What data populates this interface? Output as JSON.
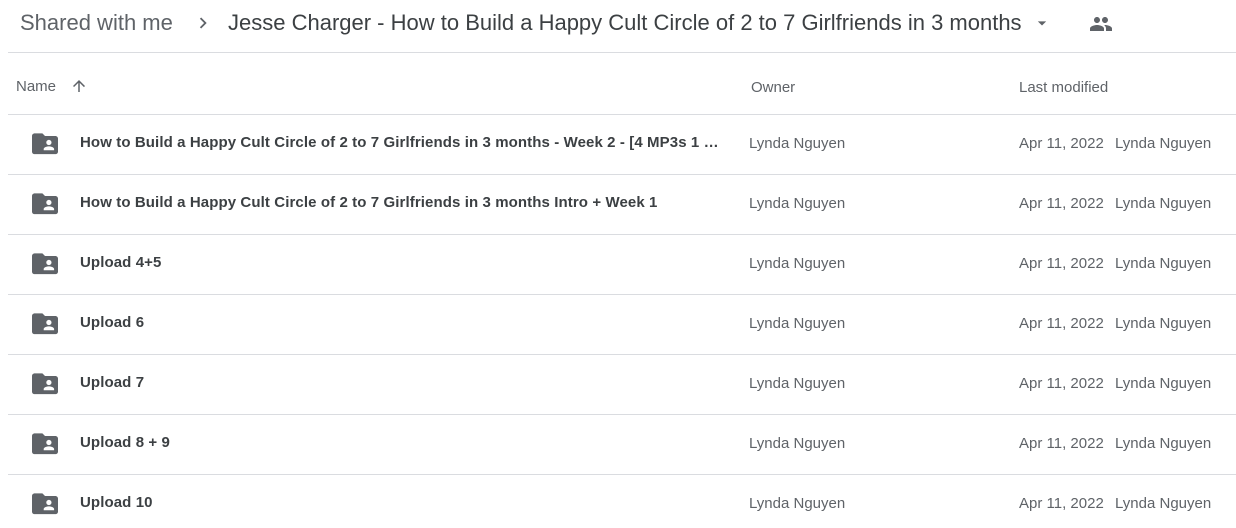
{
  "breadcrumb": {
    "root": "Shared with me",
    "current": "Jesse Charger - How to Build a Happy Cult Circle of 2 to 7 Girlfriends in 3 months"
  },
  "columns": {
    "name": "Name",
    "owner": "Owner",
    "last_modified": "Last modified",
    "sort_direction": "ascending"
  },
  "rows": [
    {
      "name": "How to Build a Happy Cult Circle of 2 to 7 Girlfriends in 3 months - Week 2 - [4 MP3s 1 …",
      "owner": "Lynda Nguyen",
      "modified": "Apr 11, 2022",
      "modified_by": "Lynda Nguyen",
      "icon": "shared-folder-icon"
    },
    {
      "name": "How to Build a Happy Cult Circle of 2 to 7 Girlfriends in 3 months Intro + Week 1",
      "owner": "Lynda Nguyen",
      "modified": "Apr 11, 2022",
      "modified_by": "Lynda Nguyen",
      "icon": "shared-folder-icon"
    },
    {
      "name": "Upload 4+5",
      "owner": "Lynda Nguyen",
      "modified": "Apr 11, 2022",
      "modified_by": "Lynda Nguyen",
      "icon": "shared-folder-icon"
    },
    {
      "name": "Upload 6",
      "owner": "Lynda Nguyen",
      "modified": "Apr 11, 2022",
      "modified_by": "Lynda Nguyen",
      "icon": "shared-folder-icon"
    },
    {
      "name": "Upload 7",
      "owner": "Lynda Nguyen",
      "modified": "Apr 11, 2022",
      "modified_by": "Lynda Nguyen",
      "icon": "shared-folder-icon"
    },
    {
      "name": "Upload 8 + 9",
      "owner": "Lynda Nguyen",
      "modified": "Apr 11, 2022",
      "modified_by": "Lynda Nguyen",
      "icon": "shared-folder-icon"
    },
    {
      "name": "Upload 10",
      "owner": "Lynda Nguyen",
      "modified": "Apr 11, 2022",
      "modified_by": "Lynda Nguyen",
      "icon": "shared-folder-icon"
    }
  ],
  "colors": {
    "text_primary": "#3c4043",
    "text_secondary": "#5f6368",
    "divider": "#dadce0",
    "icon": "#5f6368"
  }
}
